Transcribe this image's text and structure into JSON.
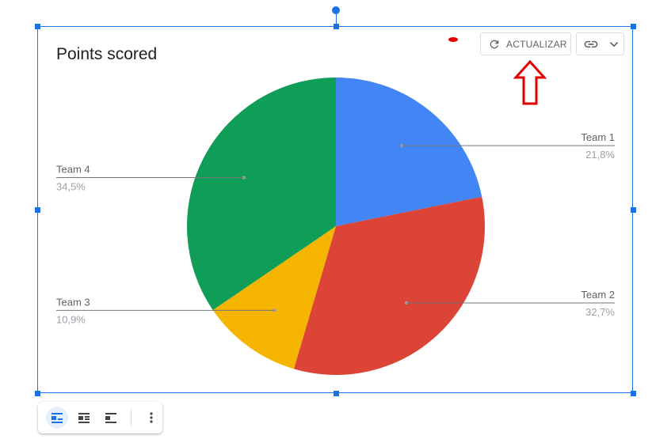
{
  "chart_data": {
    "type": "pie",
    "title": "Points scored",
    "slices": [
      {
        "name": "Team 1",
        "value": 21.8,
        "label": "21,8%",
        "color": "#4285f4"
      },
      {
        "name": "Team 2",
        "value": 32.7,
        "label": "32,7%",
        "color": "#db4437"
      },
      {
        "name": "Team 3",
        "value": 10.9,
        "label": "10,9%",
        "color": "#f4b400"
      },
      {
        "name": "Team 4",
        "value": 34.5,
        "label": "34,5%",
        "color": "#0f9d58"
      }
    ],
    "legend": "labeled"
  },
  "toolbar": {
    "update_label": "ACTUALIZAR",
    "update_icon": "refresh-icon",
    "link_icon": "link-icon",
    "dropdown_icon": "chevron-down-icon"
  },
  "layout_toolbar": {
    "icons": [
      "inline-layout-icon",
      "wrap-text-icon",
      "break-text-icon",
      "more-vert-icon"
    ]
  },
  "colors": {
    "selection": "#1a73e8",
    "annotation_arrow": "#e00000"
  }
}
